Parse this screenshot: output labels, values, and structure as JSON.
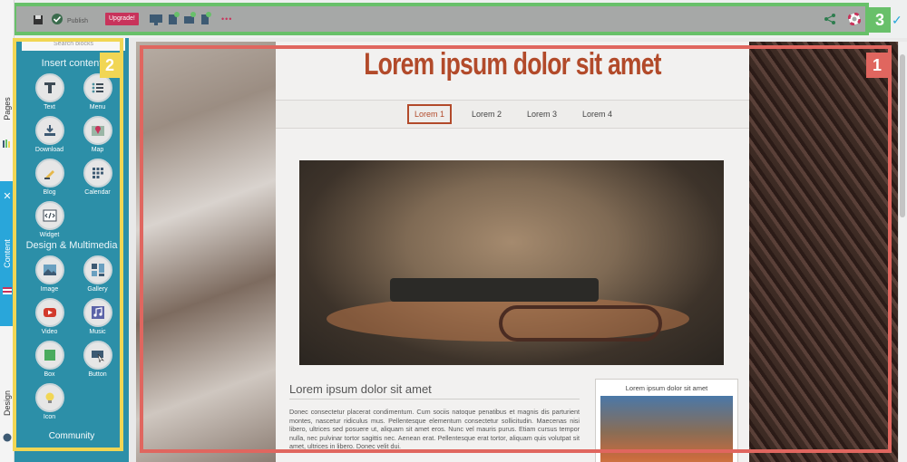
{
  "left_strip": {
    "pages_label": "Pages",
    "content_label": "Content",
    "design_label": "Design"
  },
  "panel": {
    "top_label": "Search blocks",
    "insert_heading": "Insert content",
    "insert_items": [
      {
        "label": "Text",
        "icon": "text-icon"
      },
      {
        "label": "Menu",
        "icon": "menu-icon"
      },
      {
        "label": "Download",
        "icon": "download-icon"
      },
      {
        "label": "Map",
        "icon": "map-icon"
      },
      {
        "label": "Blog",
        "icon": "blog-icon"
      },
      {
        "label": "Calendar",
        "icon": "calendar-icon"
      },
      {
        "label": "Widget",
        "icon": "widget-icon"
      }
    ],
    "design_heading": "Design & Multimedia",
    "design_items": [
      {
        "label": "Image",
        "icon": "image-icon"
      },
      {
        "label": "Gallery",
        "icon": "gallery-icon"
      },
      {
        "label": "Video",
        "icon": "video-icon"
      },
      {
        "label": "Music",
        "icon": "music-icon"
      },
      {
        "label": "Box",
        "icon": "box-icon"
      },
      {
        "label": "Button",
        "icon": "button-icon"
      },
      {
        "label": "Icon",
        "icon": "icon-icon"
      }
    ],
    "community_heading": "Community"
  },
  "toolbar": {
    "publish_label": "Publish",
    "upgrade_label": "Upgrade!",
    "more_label": "•••"
  },
  "badges": {
    "one": "1",
    "two": "2",
    "three": "3"
  },
  "page": {
    "site_title": "Lorem ipsum dolor sit amet",
    "nav": [
      "Lorem 1",
      "Lorem 2",
      "Lorem 3",
      "Lorem 4"
    ],
    "active_nav": "Lorem 1",
    "article_title": "Lorem ipsum dolor sit amet",
    "article_body": "Donec consectetur placerat condimentum. Cum sociis natoque penatibus et magnis dis parturient montes, nascetur ridiculus mus. Pellentesque elementum consectetur sollicitudin. Maecenas nisi libero, ultrices sed posuere ut, aliquam sit amet eros. Nunc vel mauris purus. Etiam cursus tempor nulla, nec pulvinar tortor sagittis nec. Aenean erat. Pellentesque erat tortor, aliquam quis volutpat sit amet, ultrices in libero. Donec velit dui.",
    "sidebox_caption": "Lorem ipsum dolor sit amet"
  },
  "colors": {
    "content_tab": "#29a6da",
    "panel_bg": "#2c8fa8",
    "highlight_1": "#e0665f",
    "highlight_2": "#f1d654",
    "highlight_3": "#68c06a",
    "title_color": "#b24a2a",
    "upgrade_bg": "#c8335b"
  }
}
